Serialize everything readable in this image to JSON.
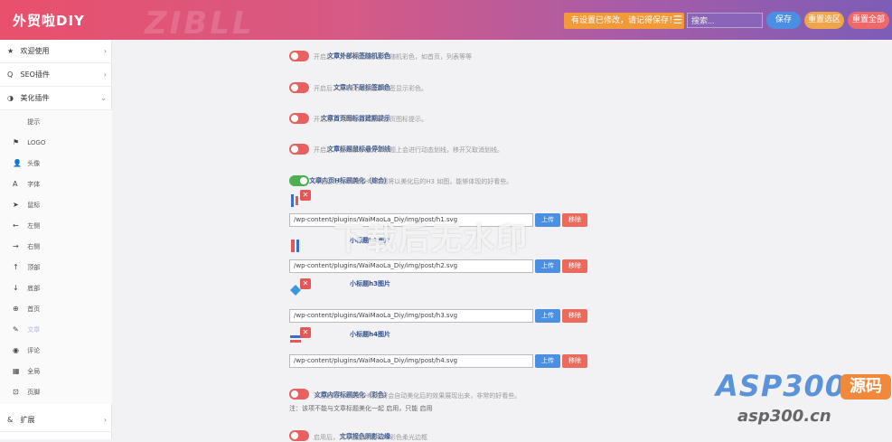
{
  "header": {
    "brand": "外贸啦DIY",
    "brand_ghost": "ZIBLL",
    "notice": "有设置已修改，请记得保存！",
    "search_placeholder": "搜索...",
    "save": "保存",
    "reset_section": "重置选区",
    "reset_all": "重置全部"
  },
  "sidebar": {
    "items": [
      {
        "icon": "★",
        "label": "欢迎使用",
        "chev": "›"
      },
      {
        "icon": "Q",
        "label": "SEO插件",
        "chev": "›"
      },
      {
        "icon": "◑",
        "label": "美化插件",
        "chev": "⌄"
      }
    ],
    "subitems": [
      {
        "icon": "",
        "label": "提示"
      },
      {
        "icon": "⚑",
        "label": "LOGO"
      },
      {
        "icon": "👤",
        "label": "头像"
      },
      {
        "icon": "A",
        "label": "字体"
      },
      {
        "icon": "➤",
        "label": "鼠标"
      },
      {
        "icon": "←",
        "label": "左侧"
      },
      {
        "icon": "→",
        "label": "右侧"
      },
      {
        "icon": "↑",
        "label": "顶部"
      },
      {
        "icon": "↓",
        "label": "底部"
      },
      {
        "icon": "⊕",
        "label": "首页"
      },
      {
        "icon": "✎",
        "label": "文章"
      },
      {
        "icon": "◉",
        "label": "评论"
      },
      {
        "icon": "▦",
        "label": "全局"
      },
      {
        "icon": "⊡",
        "label": "页脚"
      }
    ],
    "bottom": {
      "icon": "&",
      "label": "扩展",
      "chev": "›"
    }
  },
  "content": {
    "rows": [
      {
        "label": "文章外部标签随机彩色",
        "toggle": "off",
        "desc": "开启后，文章页面底部显示随机彩色，如首页，列表等等"
      },
      {
        "label": "文章内下层标签颜色",
        "toggle": "off",
        "desc": "开启后，文章页内部底下标签显示彩色。"
      },
      {
        "label": "文章首页图标首建期提示",
        "toggle": "off",
        "desc": "开启后，为网站首页显示首页图标提示。"
      },
      {
        "label": "文章标题鼠标悬停划线",
        "toggle": "off",
        "desc": "开启后，鼠标悬停在文章标题上会进行动态划线，移开又取消划线。"
      },
      {
        "label": "文章内页H标题美化（综合）",
        "toggle": "on",
        "desc": "开启后写文章用的H小标题将以美化后的H3 如图，能够体现的好看些。"
      }
    ],
    "images": [
      {
        "label": "",
        "path": "/wp-content/plugins/WaiMaoLa_Diy/img/post/h1.svg",
        "up": "上传",
        "rm": "移除"
      },
      {
        "label": "小标题h2图片",
        "path": "/wp-content/plugins/WaiMaoLa_Diy/img/post/h2.svg",
        "up": "上传",
        "rm": "移除"
      },
      {
        "label": "小标题h3图片",
        "path": "/wp-content/plugins/WaiMaoLa_Diy/img/post/h3.svg",
        "up": "上传",
        "rm": "移除"
      },
      {
        "label": "小标题h4图片",
        "path": "/wp-content/plugins/WaiMaoLa_Diy/img/post/h4.svg",
        "up": "上传",
        "rm": "移除"
      }
    ],
    "bottom_rows": [
      {
        "label": "文章内容标题美化（彩色）",
        "toggle": "off",
        "desc": "开启后写文章用的H标题将会自动美化后的效果展现出来，非常的好看些。",
        "note": "注：该项不能与文章标题美化一起 启用，只能 启用"
      },
      {
        "label": "文章接色阴影边缘",
        "toggle": "off",
        "desc": "启用后，文章底部添加一个彩色柔光边框"
      }
    ],
    "watermark": "下载后无水印",
    "site_logo": "ASP300",
    "site_tag": "源码",
    "site_url": "asp300.cn"
  }
}
